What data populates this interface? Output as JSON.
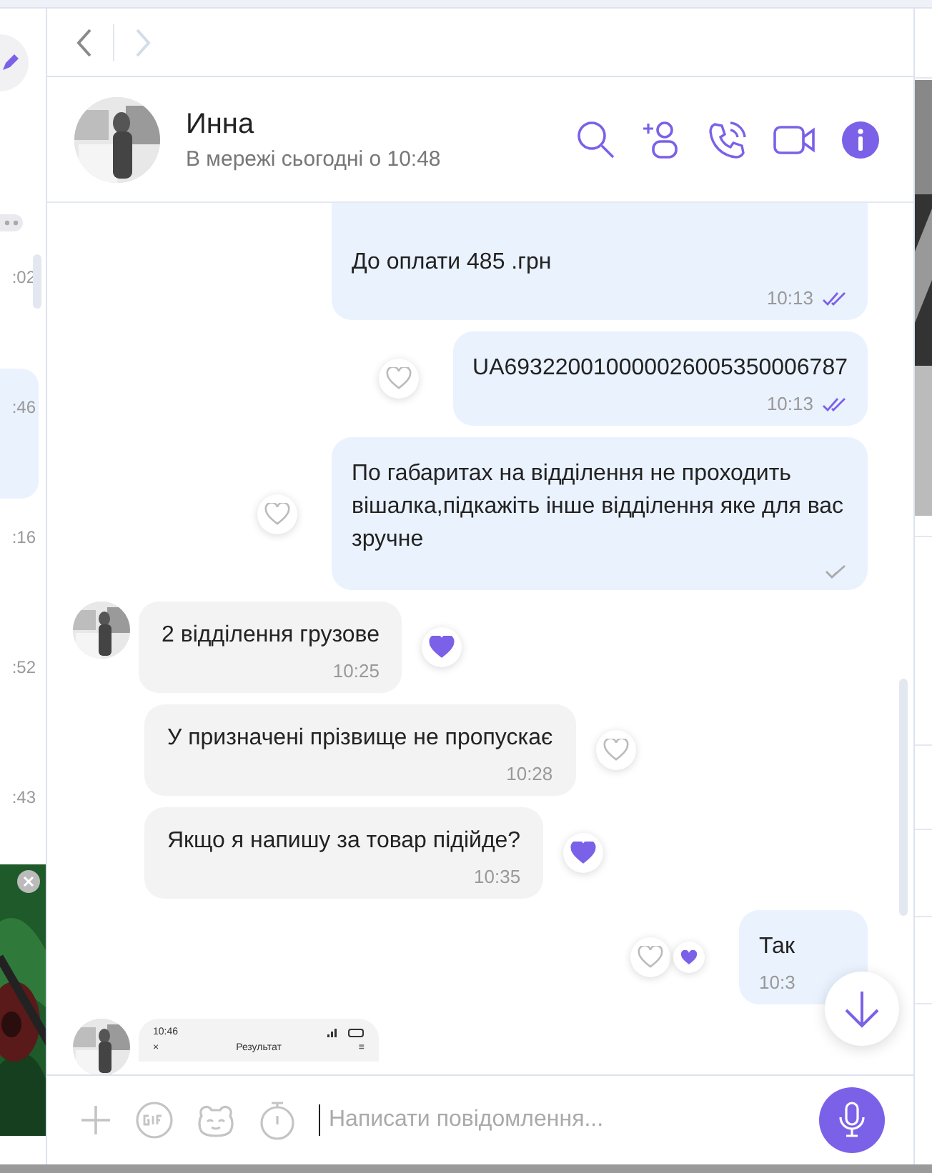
{
  "chat_list": {
    "items": [
      {
        "time": ":02",
        "selected": false
      },
      {
        "time": ":46",
        "selected": true
      },
      {
        "time": ":16",
        "selected": false
      },
      {
        "time": ":52",
        "selected": false
      },
      {
        "time": ":43",
        "selected": false
      }
    ]
  },
  "navigation": {
    "back_enabled": true,
    "forward_enabled": false
  },
  "contact": {
    "name": "Инна",
    "status": "В мережі сьогодні о 10:48"
  },
  "messages": [
    {
      "kind": "text",
      "outgoing": true,
      "text": "До оплати 485 .грн",
      "time": "10:13",
      "read": true
    },
    {
      "kind": "text",
      "outgoing": true,
      "text": "UA693220010000026005350006787",
      "time": "10:13",
      "read": true,
      "liked": false
    },
    {
      "kind": "text",
      "outgoing": true,
      "text": "По габаритах на відділення не проходить вішалка,підкажіть інше відділення яке для вас зручне",
      "read": false,
      "liked": false
    },
    {
      "kind": "text",
      "outgoing": false,
      "avatar": true,
      "text": "2 відділення грузове",
      "time": "10:25",
      "liked": true
    },
    {
      "kind": "text",
      "outgoing": false,
      "avatar": false,
      "text": "У призначені прізвище не пропускає",
      "time": "10:28",
      "liked": false
    },
    {
      "kind": "text",
      "outgoing": false,
      "avatar": false,
      "text": "Якщо я напишу за товар підійде?",
      "time": "10:35",
      "liked": true
    },
    {
      "kind": "text",
      "outgoing": true,
      "text": "Так",
      "time": "10:3",
      "liked": false,
      "liked_by_other": true
    },
    {
      "kind": "screenshot",
      "outgoing": false,
      "avatar": true,
      "clock": "10:46",
      "close_mark": "×",
      "screen_title": "Результат",
      "menu_mark": "≡"
    }
  ],
  "composer": {
    "placeholder": "Написати повідомлення..."
  }
}
